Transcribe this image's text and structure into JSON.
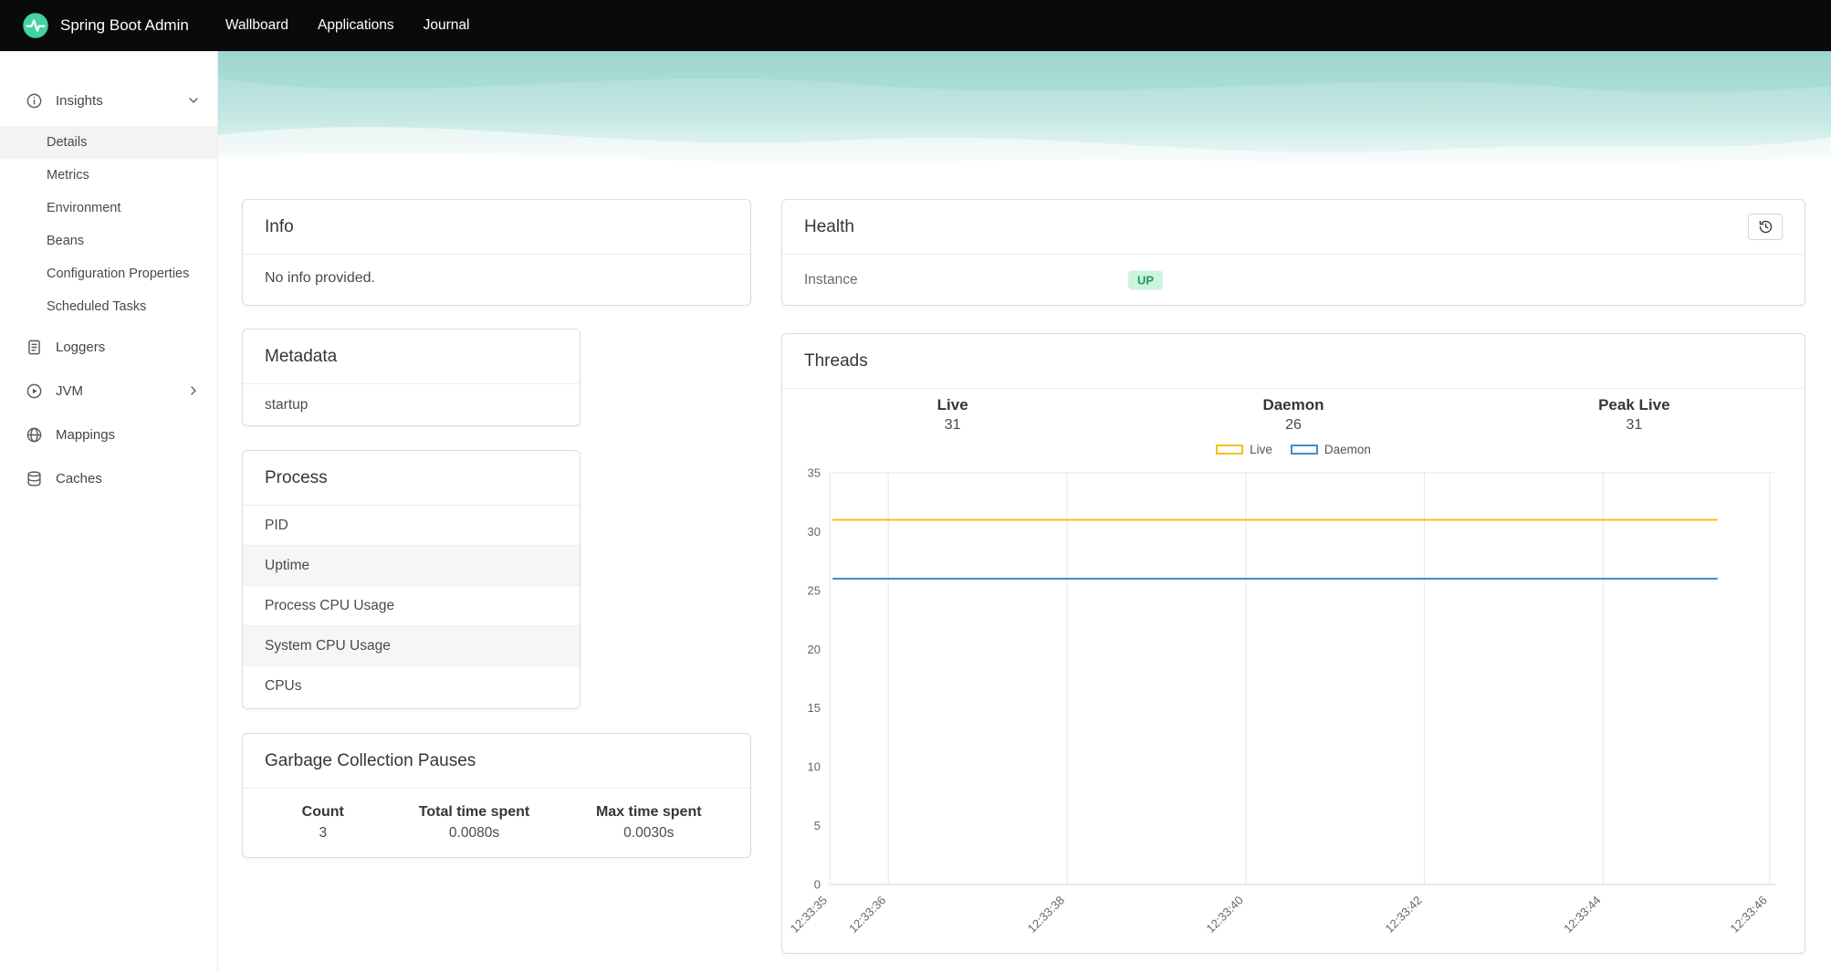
{
  "navbar": {
    "brand": "Spring Boot Admin",
    "items": [
      {
        "label": "Wallboard"
      },
      {
        "label": "Applications"
      },
      {
        "label": "Journal"
      }
    ]
  },
  "sidebar": {
    "insights": {
      "label": "Insights"
    },
    "insights_children": [
      {
        "label": "Details",
        "selected": true
      },
      {
        "label": "Metrics"
      },
      {
        "label": "Environment"
      },
      {
        "label": "Beans"
      },
      {
        "label": "Configuration Properties"
      },
      {
        "label": "Scheduled Tasks"
      }
    ],
    "items": [
      {
        "label": "Loggers"
      },
      {
        "label": "JVM"
      },
      {
        "label": "Mappings"
      },
      {
        "label": "Caches"
      }
    ]
  },
  "cards": {
    "info": {
      "title": "Info",
      "body": "No info provided."
    },
    "metadata": {
      "title": "Metadata",
      "rows": [
        {
          "name": "startup"
        }
      ]
    },
    "process": {
      "title": "Process",
      "rows": [
        {
          "name": "PID"
        },
        {
          "name": "Uptime"
        },
        {
          "name": "Process CPU Usage"
        },
        {
          "name": "System CPU Usage"
        },
        {
          "name": "CPUs"
        }
      ]
    },
    "gc": {
      "title": "Garbage Collection Pauses",
      "columns": [
        "Count",
        "Total time spent",
        "Max time spent"
      ],
      "values": [
        "3",
        "0.0080s",
        "0.0030s"
      ]
    },
    "health": {
      "title": "Health",
      "rows": [
        {
          "name": "Instance",
          "status": "UP"
        }
      ],
      "status_colors": {
        "bg": "#ccf3dd",
        "text": "#27945f"
      }
    },
    "threads": {
      "title": "Threads",
      "stats": [
        {
          "label": "Live",
          "value": "31"
        },
        {
          "label": "Daemon",
          "value": "26"
        },
        {
          "label": "Peak Live",
          "value": "31"
        }
      ]
    }
  },
  "chart_data": {
    "type": "line",
    "title": "Threads",
    "legend_position": "top",
    "ylim": [
      0,
      35
    ],
    "y_ticks": [
      35,
      30,
      25,
      20,
      15,
      10,
      5,
      0
    ],
    "x_ticks": [
      {
        "label": "12:33:35",
        "f": 0.0
      },
      {
        "label": "12:33:36",
        "f": 0.062
      },
      {
        "label": "12:33:38",
        "f": 0.251
      },
      {
        "label": "12:33:40",
        "f": 0.44
      },
      {
        "label": "12:33:42",
        "f": 0.629
      },
      {
        "label": "12:33:44",
        "f": 0.818
      },
      {
        "label": "12:33:46",
        "f": 0.994
      }
    ],
    "grid": {
      "vertical": true,
      "horizontal_at": [
        35,
        0
      ]
    },
    "series": [
      {
        "name": "Live",
        "color": "#f1c40f",
        "points": [
          {
            "f": 0.003,
            "v": 31
          },
          {
            "f": 0.939,
            "v": 31
          }
        ]
      },
      {
        "name": "Daemon",
        "color": "#3e8ed0",
        "points": [
          {
            "f": 0.003,
            "v": 26
          },
          {
            "f": 0.939,
            "v": 26
          }
        ]
      }
    ]
  },
  "colors": {
    "brand_green": "#42d3a5",
    "navbar_bg": "#0a0a0a",
    "wave_teal": "#a5d9d2"
  }
}
